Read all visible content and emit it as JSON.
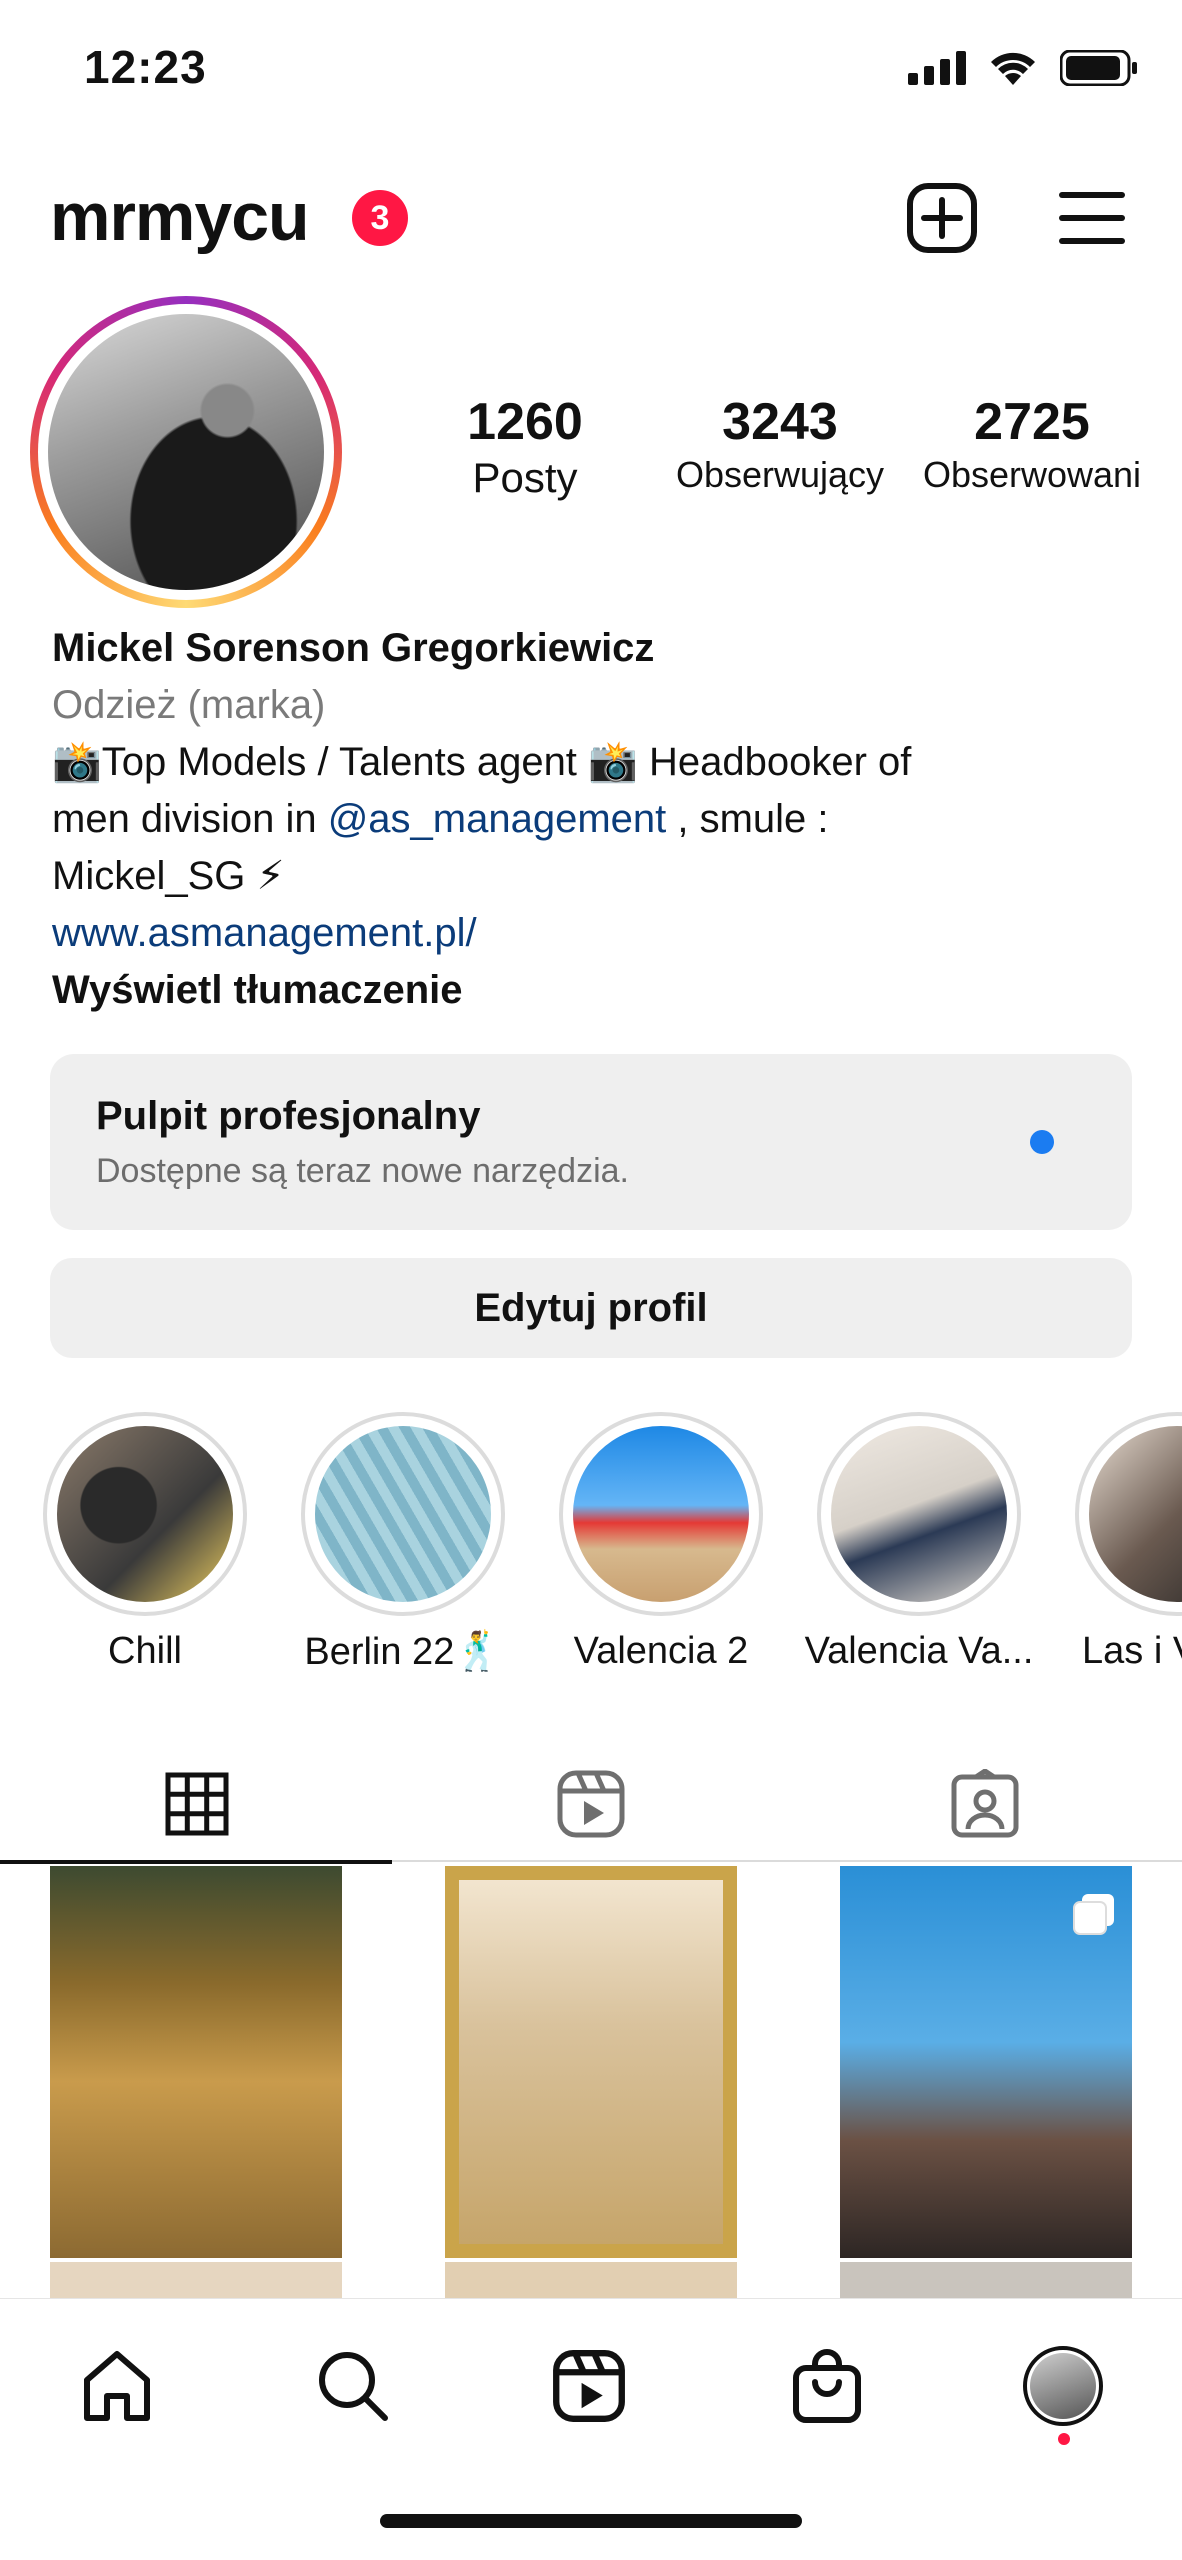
{
  "status_bar": {
    "time": "12:23"
  },
  "header": {
    "username": "mrmycu",
    "notification_count": "3"
  },
  "profile": {
    "stats": {
      "posts_count": "1260",
      "posts_label": "Posty",
      "followers_count": "3243",
      "followers_label": "Obserwujący",
      "following_count": "2725",
      "following_label": "Obserwowani"
    },
    "bio": {
      "name": "Mickel Sorenson Gregorkiewicz",
      "category": "Odzież (marka)",
      "line1": "📸Top Models / Talents agent 📸 Headbooker of",
      "line2_prefix": "men division in ",
      "mention": "@as_management",
      "line2_suffix": " , smule :",
      "line3": "Mickel_SG ⚡",
      "link": "www.asmanagement.pl/",
      "translate": "Wyświetl tłumaczenie"
    }
  },
  "dashboard": {
    "title": "Pulpit profesjonalny",
    "subtitle": "Dostępne są teraz nowe narzędzia.",
    "dot_color": "#1b7cf1"
  },
  "edit_profile_label": "Edytuj profil",
  "highlights": [
    {
      "label": "Chill"
    },
    {
      "label": "Berlin 22🕺"
    },
    {
      "label": "Valencia 2"
    },
    {
      "label": "Valencia Va..."
    },
    {
      "label": "Las i V"
    }
  ],
  "tabs": {
    "active": "grid-tab",
    "icons": [
      "grid-icon",
      "reels-icon",
      "tagged-icon"
    ]
  },
  "bottom_nav": {
    "icons": [
      "home-icon",
      "search-icon",
      "reels-icon",
      "shop-icon",
      "profile-avatar"
    ]
  },
  "colors": {
    "badge": "#ff1744",
    "link": "#0b3c7a",
    "accent_blue": "#1b7cf1"
  }
}
